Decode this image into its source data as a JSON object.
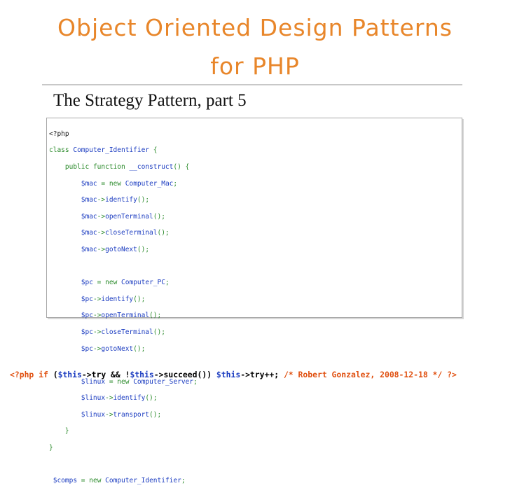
{
  "slide": {
    "title_line1": "Object Oriented Design Patterns",
    "title_line2": "for PHP",
    "subtitle": "The Strategy Pattern, part 5"
  },
  "code": {
    "open_tag": "<?php",
    "class_kw": "class",
    "class_name": "Computer_Identifier",
    "public_kw": "public",
    "function_kw": "function",
    "construct_name": "__construct",
    "new_kw": "new",
    "mac_var": "$mac",
    "mac_class": "Computer_Mac",
    "pc_var": "$pc",
    "pc_class": "Computer_PC",
    "linux_var": "$linux",
    "linux_class": "Computer_Server",
    "comps_var": "$comps",
    "m_identify": "identify",
    "m_open": "openTerminal",
    "m_close": "closeTerminal",
    "m_next": "gotoNext",
    "m_transport": "transport"
  },
  "footer": {
    "open_tag": "<?php",
    "if_kw": "if",
    "this_var": "$this",
    "try_text": "->try && !",
    "succeed_text": "->succeed())",
    "tryinc_text": "->try++;",
    "comment": "/* Robert Gonzalez, 2008-12-18 */",
    "close_tag": "?>"
  }
}
